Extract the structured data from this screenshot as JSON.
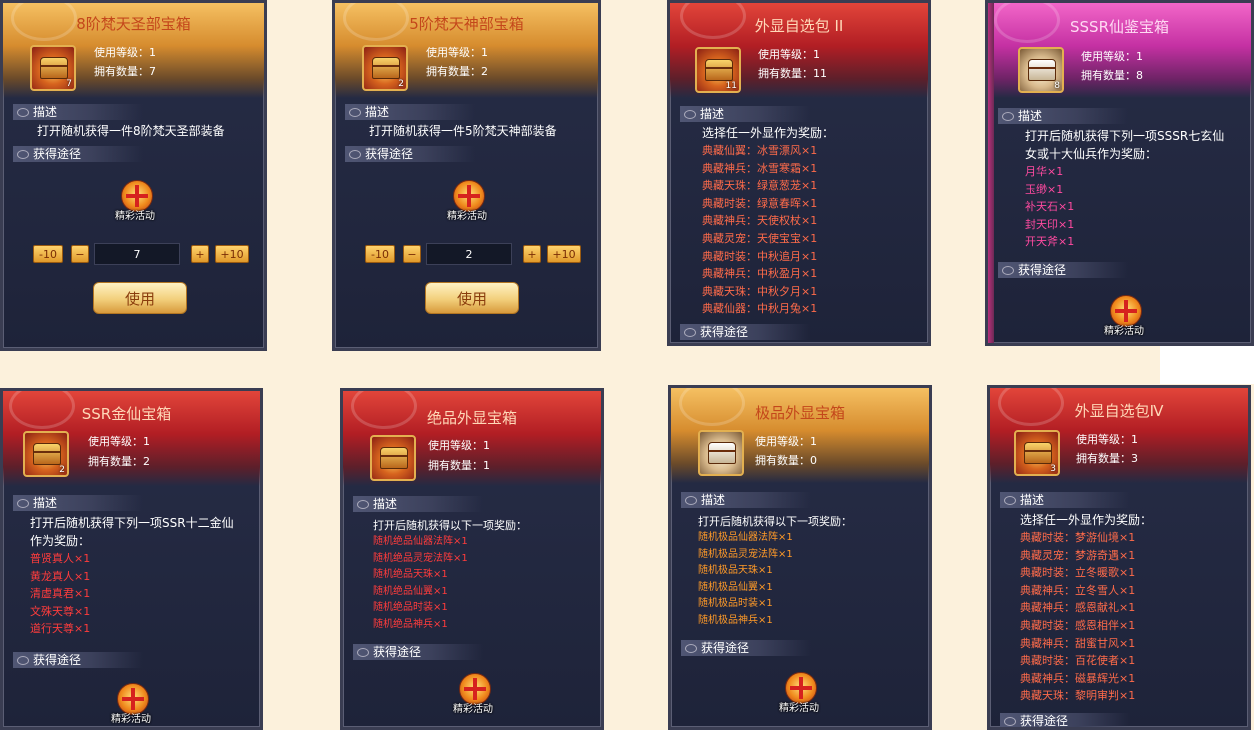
{
  "labels": {
    "use_level": "使用等级：",
    "owned": "拥有数量：",
    "desc": "描述",
    "obtain": "获得途径",
    "activity": "精彩活动",
    "use": "使用",
    "minus10": "-10",
    "minus": "−",
    "plus": "+",
    "plus10": "+10"
  },
  "cards": [
    {
      "title": "8阶梵天圣部宝箱",
      "level": "1",
      "count": "7",
      "icon_count": "7",
      "desc": "打开随机获得一件8阶梵天圣部装备",
      "qty": "7"
    },
    {
      "title": "5阶梵天神部宝箱",
      "level": "1",
      "count": "2",
      "icon_count": "2",
      "desc": "打开随机获得一件5阶梵天神部装备",
      "qty": "2"
    },
    {
      "title": "外显自选包 II",
      "level": "1",
      "count": "11",
      "icon_count": "11",
      "desc": "选择任一外显作为奖励：",
      "rewards": [
        "典藏仙翼：冰雪漂风×1",
        "典藏神兵：冰雪寒霜×1",
        "典藏天珠：绿意葱茏×1",
        "典藏时装：绿意春晖×1",
        "典藏神兵：天使权杖×1",
        "典藏灵宠：天使宝宝×1",
        "典藏时装：中秋追月×1",
        "典藏神兵：中秋盈月×1",
        "典藏天珠：中秋夕月×1",
        "典藏仙器：中秋月兔×1"
      ]
    },
    {
      "title": "SSSR仙鉴宝箱",
      "level": "1",
      "count": "8",
      "icon_count": "8",
      "desc1": "打开后随机获得下列一项SSSR七玄仙",
      "desc2": "女或十大仙兵作为奖励：",
      "rewards": [
        "月华×1",
        "玉缈×1",
        "补天石×1",
        "封天印×1",
        "开天斧×1"
      ]
    },
    {
      "title": "SSR金仙宝箱",
      "level": "1",
      "count": "2",
      "icon_count": "2",
      "desc1": "打开后随机获得下列一项SSR十二金仙",
      "desc2": "作为奖励：",
      "rewards": [
        "普贤真人×1",
        "黄龙真人×1",
        "清虚真君×1",
        "文殊天尊×1",
        "道行天尊×1"
      ]
    },
    {
      "title": "绝品外显宝箱",
      "level": "1",
      "count": "1",
      "desc": "打开后随机获得以下一项奖励：",
      "rewards": [
        "随机绝品仙器法阵×1",
        "随机绝品灵宠法阵×1",
        "随机绝品天珠×1",
        "随机绝品仙翼×1",
        "随机绝品时装×1",
        "随机绝品神兵×1"
      ]
    },
    {
      "title": "极品外显宝箱",
      "level": "1",
      "count": "0",
      "desc": "打开后随机获得以下一项奖励：",
      "rewards": [
        "随机极品仙器法阵×1",
        "随机极品灵宠法阵×1",
        "随机极品天珠×1",
        "随机极品仙翼×1",
        "随机极品时装×1",
        "随机极品神兵×1"
      ]
    },
    {
      "title": "外显自选包Ⅳ",
      "level": "1",
      "count": "3",
      "icon_count": "3",
      "desc": "选择任一外显作为奖励：",
      "rewards": [
        "典藏时装：梦游仙境×1",
        "典藏灵宠：梦游奇遇×1",
        "典藏时装：立冬暖歌×1",
        "典藏神兵：立冬雪人×1",
        "典藏神兵：感恩献礼×1",
        "典藏时装：感恩相伴×1",
        "典藏神兵：甜蜜甘风×1",
        "典藏时装：百花使者×1",
        "典藏神兵：磁暴辉光×1",
        "典藏天珠：黎明审判×1"
      ]
    }
  ],
  "colors": {
    "gold_header": "#d68c2e",
    "red_header": "#b21e24",
    "pink_header": "#c531a3",
    "reward_red": "#ff3c3c",
    "reward_orange": "#ff9a28",
    "panel_bg": "#272d47",
    "page_bg": "#fcf1dc"
  }
}
